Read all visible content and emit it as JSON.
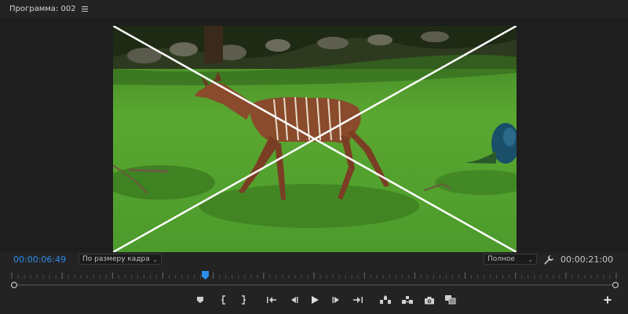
{
  "panel": {
    "title": "Программа: 002",
    "menu_icon": "hamburger-icon"
  },
  "playback": {
    "current_timecode": "00:00:06:49",
    "duration_timecode": "00:00:21:00",
    "playhead_fraction": 0.32
  },
  "fit_select": {
    "value": "По размеру кадра"
  },
  "quality_select": {
    "value": "Полное"
  },
  "colors": {
    "background": "#232323",
    "accent": "#2d8ceb",
    "overlay_line": "#ffffff"
  },
  "controls": [
    {
      "name": "add-marker-button",
      "icon": "marker-icon"
    },
    {
      "name": "mark-in-button",
      "icon": "mark-in-icon"
    },
    {
      "name": "mark-out-button",
      "icon": "mark-out-icon"
    },
    {
      "name": "go-to-in-button",
      "icon": "go-to-in-icon"
    },
    {
      "name": "step-back-button",
      "icon": "step-back-icon"
    },
    {
      "name": "play-button",
      "icon": "play-icon"
    },
    {
      "name": "step-forward-button",
      "icon": "step-forward-icon"
    },
    {
      "name": "go-to-out-button",
      "icon": "go-to-out-icon"
    },
    {
      "name": "lift-button",
      "icon": "lift-icon"
    },
    {
      "name": "extract-button",
      "icon": "extract-icon"
    },
    {
      "name": "export-frame-button",
      "icon": "camera-icon"
    },
    {
      "name": "compare-button",
      "icon": "compare-icon"
    },
    {
      "name": "button-editor-button",
      "icon": "plus-icon"
    }
  ]
}
